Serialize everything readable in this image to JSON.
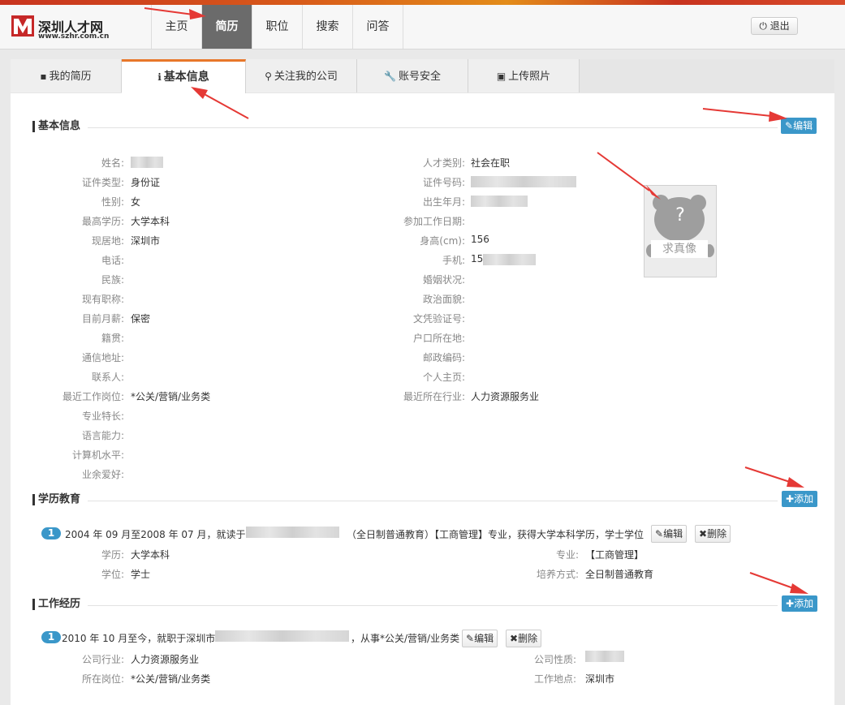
{
  "logo": {
    "name": "深圳人才网",
    "url": "www.szhr.com.cn"
  },
  "nav": [
    "主页",
    "简历",
    "职位",
    "搜索",
    "问答"
  ],
  "logout": "退出",
  "tabs": [
    {
      "label": "我的简历",
      "icon": "file-icon"
    },
    {
      "label": "基本信息",
      "icon": "info-icon"
    },
    {
      "label": "关注我的公司",
      "icon": "search-icon"
    },
    {
      "label": "账号安全",
      "icon": "wrench-icon"
    },
    {
      "label": "上传照片",
      "icon": "image-icon"
    }
  ],
  "basic": {
    "title": "基本信息",
    "edit": "编辑",
    "left": [
      {
        "label": "姓名:",
        "value": ""
      },
      {
        "label": "证件类型:",
        "value": "身份证"
      },
      {
        "label": "性别:",
        "value": "女"
      },
      {
        "label": "最高学历:",
        "value": "大学本科"
      },
      {
        "label": "现居地:",
        "value": "深圳市"
      },
      {
        "label": "电话:",
        "value": ""
      },
      {
        "label": "民族:",
        "value": ""
      },
      {
        "label": "现有职称:",
        "value": ""
      },
      {
        "label": "目前月薪:",
        "value": "保密"
      },
      {
        "label": "籍贯:",
        "value": ""
      },
      {
        "label": "通信地址:",
        "value": ""
      },
      {
        "label": "联系人:",
        "value": ""
      },
      {
        "label": "最近工作岗位:",
        "value": "*公关/营销/业务类"
      },
      {
        "label": "专业特长:",
        "value": ""
      },
      {
        "label": "语言能力:",
        "value": ""
      },
      {
        "label": "计算机水平:",
        "value": ""
      },
      {
        "label": "业余爱好:",
        "value": ""
      }
    ],
    "right": [
      {
        "label": "人才类别:",
        "value": "社会在职"
      },
      {
        "label": "证件号码:",
        "value": ""
      },
      {
        "label": "出生年月:",
        "value": ""
      },
      {
        "label": "参加工作日期:",
        "value": ""
      },
      {
        "label": "身高(cm):",
        "value": "156"
      },
      {
        "label": "手机:",
        "value": "15"
      },
      {
        "label": "婚姻状况:",
        "value": ""
      },
      {
        "label": "政治面貌:",
        "value": ""
      },
      {
        "label": "文凭验证号:",
        "value": ""
      },
      {
        "label": "户口所在地:",
        "value": ""
      },
      {
        "label": "邮政编码:",
        "value": ""
      },
      {
        "label": "个人主页:",
        "value": ""
      },
      {
        "label": "最近所在行业:",
        "value": "人力资源服务业"
      }
    ],
    "photo_text": "求真像",
    "photo_mark": "?"
  },
  "education": {
    "title": "学历教育",
    "add": "添加",
    "entries": [
      {
        "index": "1",
        "line_a": "2004 年 09 月至2008 年 07 月，就读于",
        "line_b": "（全日制普通教育）【工商管理】专业，获得大学本科学历，学士学位",
        "edit": "编辑",
        "delete": "删除",
        "fields": [
          {
            "label": "学历:",
            "value": "大学本科"
          },
          {
            "label": "专业:",
            "value": "【工商管理】"
          },
          {
            "label": "学位:",
            "value": "学士"
          },
          {
            "label": "培养方式:",
            "value": "全日制普通教育"
          }
        ]
      }
    ]
  },
  "work": {
    "title": "工作经历",
    "add": "添加",
    "entries": [
      {
        "index": "1",
        "line_a": "2010 年 10 月至今，就职于深圳市",
        "line_b": "，从事*公关/营销/业务类",
        "edit": "编辑",
        "delete": "删除",
        "fields": [
          {
            "label": "公司行业:",
            "value": "人力资源服务业"
          },
          {
            "label": "公司性质:",
            "value": ""
          },
          {
            "label": "所在岗位:",
            "value": "*公关/营销/业务类"
          },
          {
            "label": "工作地点:",
            "value": "深圳市"
          }
        ]
      }
    ]
  },
  "colors": {
    "accent": "#3a97c9",
    "active_tab": "#e8772a",
    "annotation": "#e53935"
  }
}
